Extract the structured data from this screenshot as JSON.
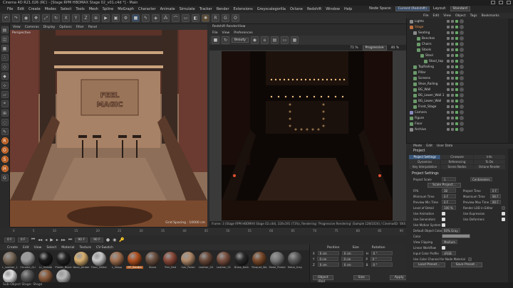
{
  "window": {
    "title": "Cinema 4D R21.026 (RC) - [Stage RPM HBOMAX Stage 02_v01.c4d *] - Main"
  },
  "menubar": {
    "items": [
      "File",
      "Edit",
      "Create",
      "Modes",
      "Select",
      "Tools",
      "Mesh",
      "Spline",
      "MoGraph",
      "Character",
      "Animate",
      "Simulate",
      "Tracker",
      "Render",
      "Extensions",
      "Greyscalegorilla",
      "Octane",
      "Redshift",
      "Window",
      "Help"
    ],
    "node_space_label": "Node Space:",
    "node_space_value": "Current (Redshift)",
    "layout_label": "Layout:",
    "layout_value": "Standard"
  },
  "viewport": {
    "menu": [
      "View",
      "Cameras",
      "Display",
      "Options",
      "Filter",
      "Panel"
    ],
    "label": "Perspective",
    "sign_line1": "FEEL",
    "sign_line2": "MAGIC",
    "grid_spacing": "Grid Spacing : 10000 cm"
  },
  "renderview": {
    "title": "Redshift RenderView",
    "menu": [
      "File",
      "View",
      "Preferences"
    ],
    "dropdown": "Beauty",
    "zoom": "71 %",
    "progressive_label": "Progressive",
    "percent": "40 %",
    "status": "Frame: 3 (Stage RPM HBOMAX Stage 02.c4d), 320x191 (71%), Rendering: 'Progressive Rendering' (Sample 128/1024) / Cinema4D: 'EKS Stage ...'"
  },
  "timeline": {
    "ticks": [
      "0",
      "5",
      "10",
      "15",
      "20",
      "25",
      "30",
      "35",
      "40",
      "45",
      "50",
      "55",
      "60",
      "65",
      "70",
      "75",
      "80",
      "85",
      "90"
    ],
    "start": "0 F",
    "current": "90 F",
    "end": "90 F",
    "frame": "0 F"
  },
  "materials": {
    "menu": [
      "Create",
      "Edit",
      "View",
      "Select",
      "Material",
      "Texture",
      "CV-Swatch"
    ],
    "items": [
      {
        "label": "L_Leather_1",
        "color": "#7a6a5a"
      },
      {
        "label": "Chrome_Gri",
        "color": "#9a9a9a"
      },
      {
        "label": "Lc_Invisibl",
        "color": "#1a1a1a"
      },
      {
        "label": "Plastic_Black",
        "color": "#222"
      },
      {
        "label": "Neon_Amber",
        "color": "#d8b070"
      },
      {
        "label": "Floor_Glitter",
        "color": "#c8c8c8"
      },
      {
        "label": "L_Stepp",
        "color": "#a07050"
      },
      {
        "label": "DT_Sandra",
        "color": "#b05020",
        "selected": true
      },
      {
        "label": "Stone",
        "color": "#6b5040"
      },
      {
        "label": "Trim_Red",
        "color": "#8a4a3a"
      },
      {
        "label": "Oak_Polish",
        "color": "#b08a6a"
      },
      {
        "label": "Leather_04",
        "color": "#6a4a3a"
      },
      {
        "label": "Leather_01",
        "color": "#7a5040"
      },
      {
        "label": "Brass_Dark",
        "color": "#2a2a2a"
      },
      {
        "label": "Parquet_Wo",
        "color": "#7a4a2a"
      },
      {
        "label": "Metal_Plated",
        "color": "#777"
      },
      {
        "label": "Metal_Grey",
        "color": "#5a5a5a"
      },
      {
        "label": "Mirror",
        "color": "#e0e0e0"
      },
      {
        "label": "Metal_Grid",
        "color": "#555"
      },
      {
        "label": "Wood_Large",
        "color": "#8a5a3a"
      },
      {
        "label": "Light_Bulb",
        "color": "#b8b8b8"
      }
    ]
  },
  "coordinates": {
    "headers": [
      "Position",
      "Size",
      "Rotation"
    ],
    "rows": [
      {
        "axis": "X",
        "pos": "0 cm",
        "size": "0 cm",
        "rot_axis": "H",
        "rot": "0 °"
      },
      {
        "axis": "Y",
        "pos": "0 cm",
        "size": "0 cm",
        "rot_axis": "P",
        "rot": "0 °"
      },
      {
        "axis": "Z",
        "pos": "0 cm",
        "size": "0 cm",
        "rot_axis": "B",
        "rot": "0 °"
      }
    ],
    "mode": "Object (Rel)",
    "size_mode": "Size",
    "apply": "Apply"
  },
  "objects": {
    "menu": [
      "File",
      "Edit",
      "View",
      "Object",
      "Tags",
      "Bookmarks"
    ],
    "rows": [
      {
        "name": "Lights",
        "indent": 0,
        "color": "#8a8a8a"
      },
      {
        "name": "Stage",
        "indent": 0,
        "color": "#c07040",
        "highlight": true
      },
      {
        "name": "Seating",
        "indent": 1,
        "color": "#8a8a8a"
      },
      {
        "name": "Benches",
        "indent": 2,
        "color": "#6a9a6a"
      },
      {
        "name": "Chairs",
        "indent": 2,
        "color": "#6a9a6a"
      },
      {
        "name": "Stools",
        "indent": 2,
        "color": "#6a9a6a"
      },
      {
        "name": "Stool",
        "indent": 3,
        "color": "#6a9a6a"
      },
      {
        "name": "Stool_top",
        "indent": 4,
        "color": "#6a9a6a"
      },
      {
        "name": "TopRailing",
        "indent": 1,
        "color": "#6a9a6a"
      },
      {
        "name": "Pillar",
        "indent": 1,
        "color": "#6a9a6a"
      },
      {
        "name": "Screens",
        "indent": 1,
        "color": "#6a9a6a"
      },
      {
        "name": "Shoe_Railing",
        "indent": 1,
        "color": "#6a9a6a"
      },
      {
        "name": "BG_Wall",
        "indent": 1,
        "color": "#6a9a6a"
      },
      {
        "name": "BG_Lower_Wall.1",
        "indent": 1,
        "color": "#6a9a6a"
      },
      {
        "name": "BG_Lower_Wall",
        "indent": 1,
        "color": "#6a9a6a"
      },
      {
        "name": "Front_Stage",
        "indent": 1,
        "color": "#6a9a6a"
      },
      {
        "name": "Camera",
        "indent": 0,
        "color": "#8a8ac0"
      },
      {
        "name": "Figure",
        "indent": 0,
        "color": "#6a9a6a"
      },
      {
        "name": "Floor",
        "indent": 0,
        "color": "#6a9a6a"
      },
      {
        "name": "Archive",
        "indent": 0,
        "color": "#8a8a8a"
      }
    ]
  },
  "attributes": {
    "menu": [
      "Mode",
      "Edit",
      "User Data"
    ],
    "title": "Project",
    "tabs": [
      "Project Settings",
      "Cineware",
      "Info",
      "Dynamics",
      "Referencing",
      "To Do",
      "Key Interpolation",
      "Scene Nodes",
      "Octane Render"
    ],
    "section": "Project Settings",
    "project_scale_label": "Project Scale",
    "project_scale_value": "1",
    "project_scale_unit": "Centimeters",
    "scale_project": "Scale Project...",
    "fps_label": "FPS",
    "fps": "30",
    "project_time_label": "Project Time",
    "project_time": "0 F",
    "min_time_label": "Minimum Time",
    "min_time": "0 F",
    "max_time_label": "Maximum Time",
    "max_time": "90 F",
    "preview_min_label": "Preview Min Time",
    "preview_min": "0 F",
    "preview_max_label": "Preview Max Time",
    "preview_max": "90 F",
    "lod_label": "Level of Detail",
    "lod": "100 %",
    "render_lod_label": "Render LOD in Editor",
    "use_animation": "Use Animation",
    "use_expression": "Use Expression",
    "use_generators": "Use Generators",
    "use_deformers": "Use Deformers",
    "use_motion": "Use Motion System",
    "default_color_label": "Default Object Color",
    "default_color": "60% Gray",
    "color_label": "Color",
    "view_clipping_label": "View Clipping",
    "view_clipping": "Medium",
    "linear_workflow": "Linear Workflow",
    "input_color_label": "Input Color Profile",
    "input_color": "sRGB",
    "use_color_channel": "Use Color Channel for Node Material",
    "load_preset": "Load Preset...",
    "save_preset": "Save Preset..."
  },
  "statusbar": {
    "text": "Sub-Object Stage: Stage"
  }
}
